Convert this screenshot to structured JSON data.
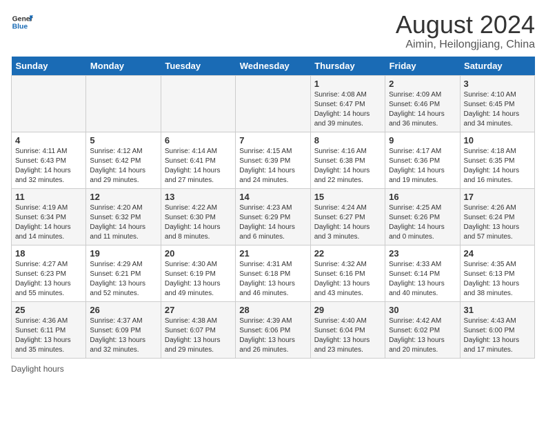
{
  "header": {
    "logo_general": "General",
    "logo_blue": "Blue",
    "month_title": "August 2024",
    "location": "Aimin, Heilongjiang, China"
  },
  "days_of_week": [
    "Sunday",
    "Monday",
    "Tuesday",
    "Wednesday",
    "Thursday",
    "Friday",
    "Saturday"
  ],
  "weeks": [
    [
      {
        "day": "",
        "info": ""
      },
      {
        "day": "",
        "info": ""
      },
      {
        "day": "",
        "info": ""
      },
      {
        "day": "",
        "info": ""
      },
      {
        "day": "1",
        "info": "Sunrise: 4:08 AM\nSunset: 6:47 PM\nDaylight: 14 hours and 39 minutes."
      },
      {
        "day": "2",
        "info": "Sunrise: 4:09 AM\nSunset: 6:46 PM\nDaylight: 14 hours and 36 minutes."
      },
      {
        "day": "3",
        "info": "Sunrise: 4:10 AM\nSunset: 6:45 PM\nDaylight: 14 hours and 34 minutes."
      }
    ],
    [
      {
        "day": "4",
        "info": "Sunrise: 4:11 AM\nSunset: 6:43 PM\nDaylight: 14 hours and 32 minutes."
      },
      {
        "day": "5",
        "info": "Sunrise: 4:12 AM\nSunset: 6:42 PM\nDaylight: 14 hours and 29 minutes."
      },
      {
        "day": "6",
        "info": "Sunrise: 4:14 AM\nSunset: 6:41 PM\nDaylight: 14 hours and 27 minutes."
      },
      {
        "day": "7",
        "info": "Sunrise: 4:15 AM\nSunset: 6:39 PM\nDaylight: 14 hours and 24 minutes."
      },
      {
        "day": "8",
        "info": "Sunrise: 4:16 AM\nSunset: 6:38 PM\nDaylight: 14 hours and 22 minutes."
      },
      {
        "day": "9",
        "info": "Sunrise: 4:17 AM\nSunset: 6:36 PM\nDaylight: 14 hours and 19 minutes."
      },
      {
        "day": "10",
        "info": "Sunrise: 4:18 AM\nSunset: 6:35 PM\nDaylight: 14 hours and 16 minutes."
      }
    ],
    [
      {
        "day": "11",
        "info": "Sunrise: 4:19 AM\nSunset: 6:34 PM\nDaylight: 14 hours and 14 minutes."
      },
      {
        "day": "12",
        "info": "Sunrise: 4:20 AM\nSunset: 6:32 PM\nDaylight: 14 hours and 11 minutes."
      },
      {
        "day": "13",
        "info": "Sunrise: 4:22 AM\nSunset: 6:30 PM\nDaylight: 14 hours and 8 minutes."
      },
      {
        "day": "14",
        "info": "Sunrise: 4:23 AM\nSunset: 6:29 PM\nDaylight: 14 hours and 6 minutes."
      },
      {
        "day": "15",
        "info": "Sunrise: 4:24 AM\nSunset: 6:27 PM\nDaylight: 14 hours and 3 minutes."
      },
      {
        "day": "16",
        "info": "Sunrise: 4:25 AM\nSunset: 6:26 PM\nDaylight: 14 hours and 0 minutes."
      },
      {
        "day": "17",
        "info": "Sunrise: 4:26 AM\nSunset: 6:24 PM\nDaylight: 13 hours and 57 minutes."
      }
    ],
    [
      {
        "day": "18",
        "info": "Sunrise: 4:27 AM\nSunset: 6:23 PM\nDaylight: 13 hours and 55 minutes."
      },
      {
        "day": "19",
        "info": "Sunrise: 4:29 AM\nSunset: 6:21 PM\nDaylight: 13 hours and 52 minutes."
      },
      {
        "day": "20",
        "info": "Sunrise: 4:30 AM\nSunset: 6:19 PM\nDaylight: 13 hours and 49 minutes."
      },
      {
        "day": "21",
        "info": "Sunrise: 4:31 AM\nSunset: 6:18 PM\nDaylight: 13 hours and 46 minutes."
      },
      {
        "day": "22",
        "info": "Sunrise: 4:32 AM\nSunset: 6:16 PM\nDaylight: 13 hours and 43 minutes."
      },
      {
        "day": "23",
        "info": "Sunrise: 4:33 AM\nSunset: 6:14 PM\nDaylight: 13 hours and 40 minutes."
      },
      {
        "day": "24",
        "info": "Sunrise: 4:35 AM\nSunset: 6:13 PM\nDaylight: 13 hours and 38 minutes."
      }
    ],
    [
      {
        "day": "25",
        "info": "Sunrise: 4:36 AM\nSunset: 6:11 PM\nDaylight: 13 hours and 35 minutes."
      },
      {
        "day": "26",
        "info": "Sunrise: 4:37 AM\nSunset: 6:09 PM\nDaylight: 13 hours and 32 minutes."
      },
      {
        "day": "27",
        "info": "Sunrise: 4:38 AM\nSunset: 6:07 PM\nDaylight: 13 hours and 29 minutes."
      },
      {
        "day": "28",
        "info": "Sunrise: 4:39 AM\nSunset: 6:06 PM\nDaylight: 13 hours and 26 minutes."
      },
      {
        "day": "29",
        "info": "Sunrise: 4:40 AM\nSunset: 6:04 PM\nDaylight: 13 hours and 23 minutes."
      },
      {
        "day": "30",
        "info": "Sunrise: 4:42 AM\nSunset: 6:02 PM\nDaylight: 13 hours and 20 minutes."
      },
      {
        "day": "31",
        "info": "Sunrise: 4:43 AM\nSunset: 6:00 PM\nDaylight: 13 hours and 17 minutes."
      }
    ]
  ],
  "footer": {
    "daylight_label": "Daylight hours"
  }
}
